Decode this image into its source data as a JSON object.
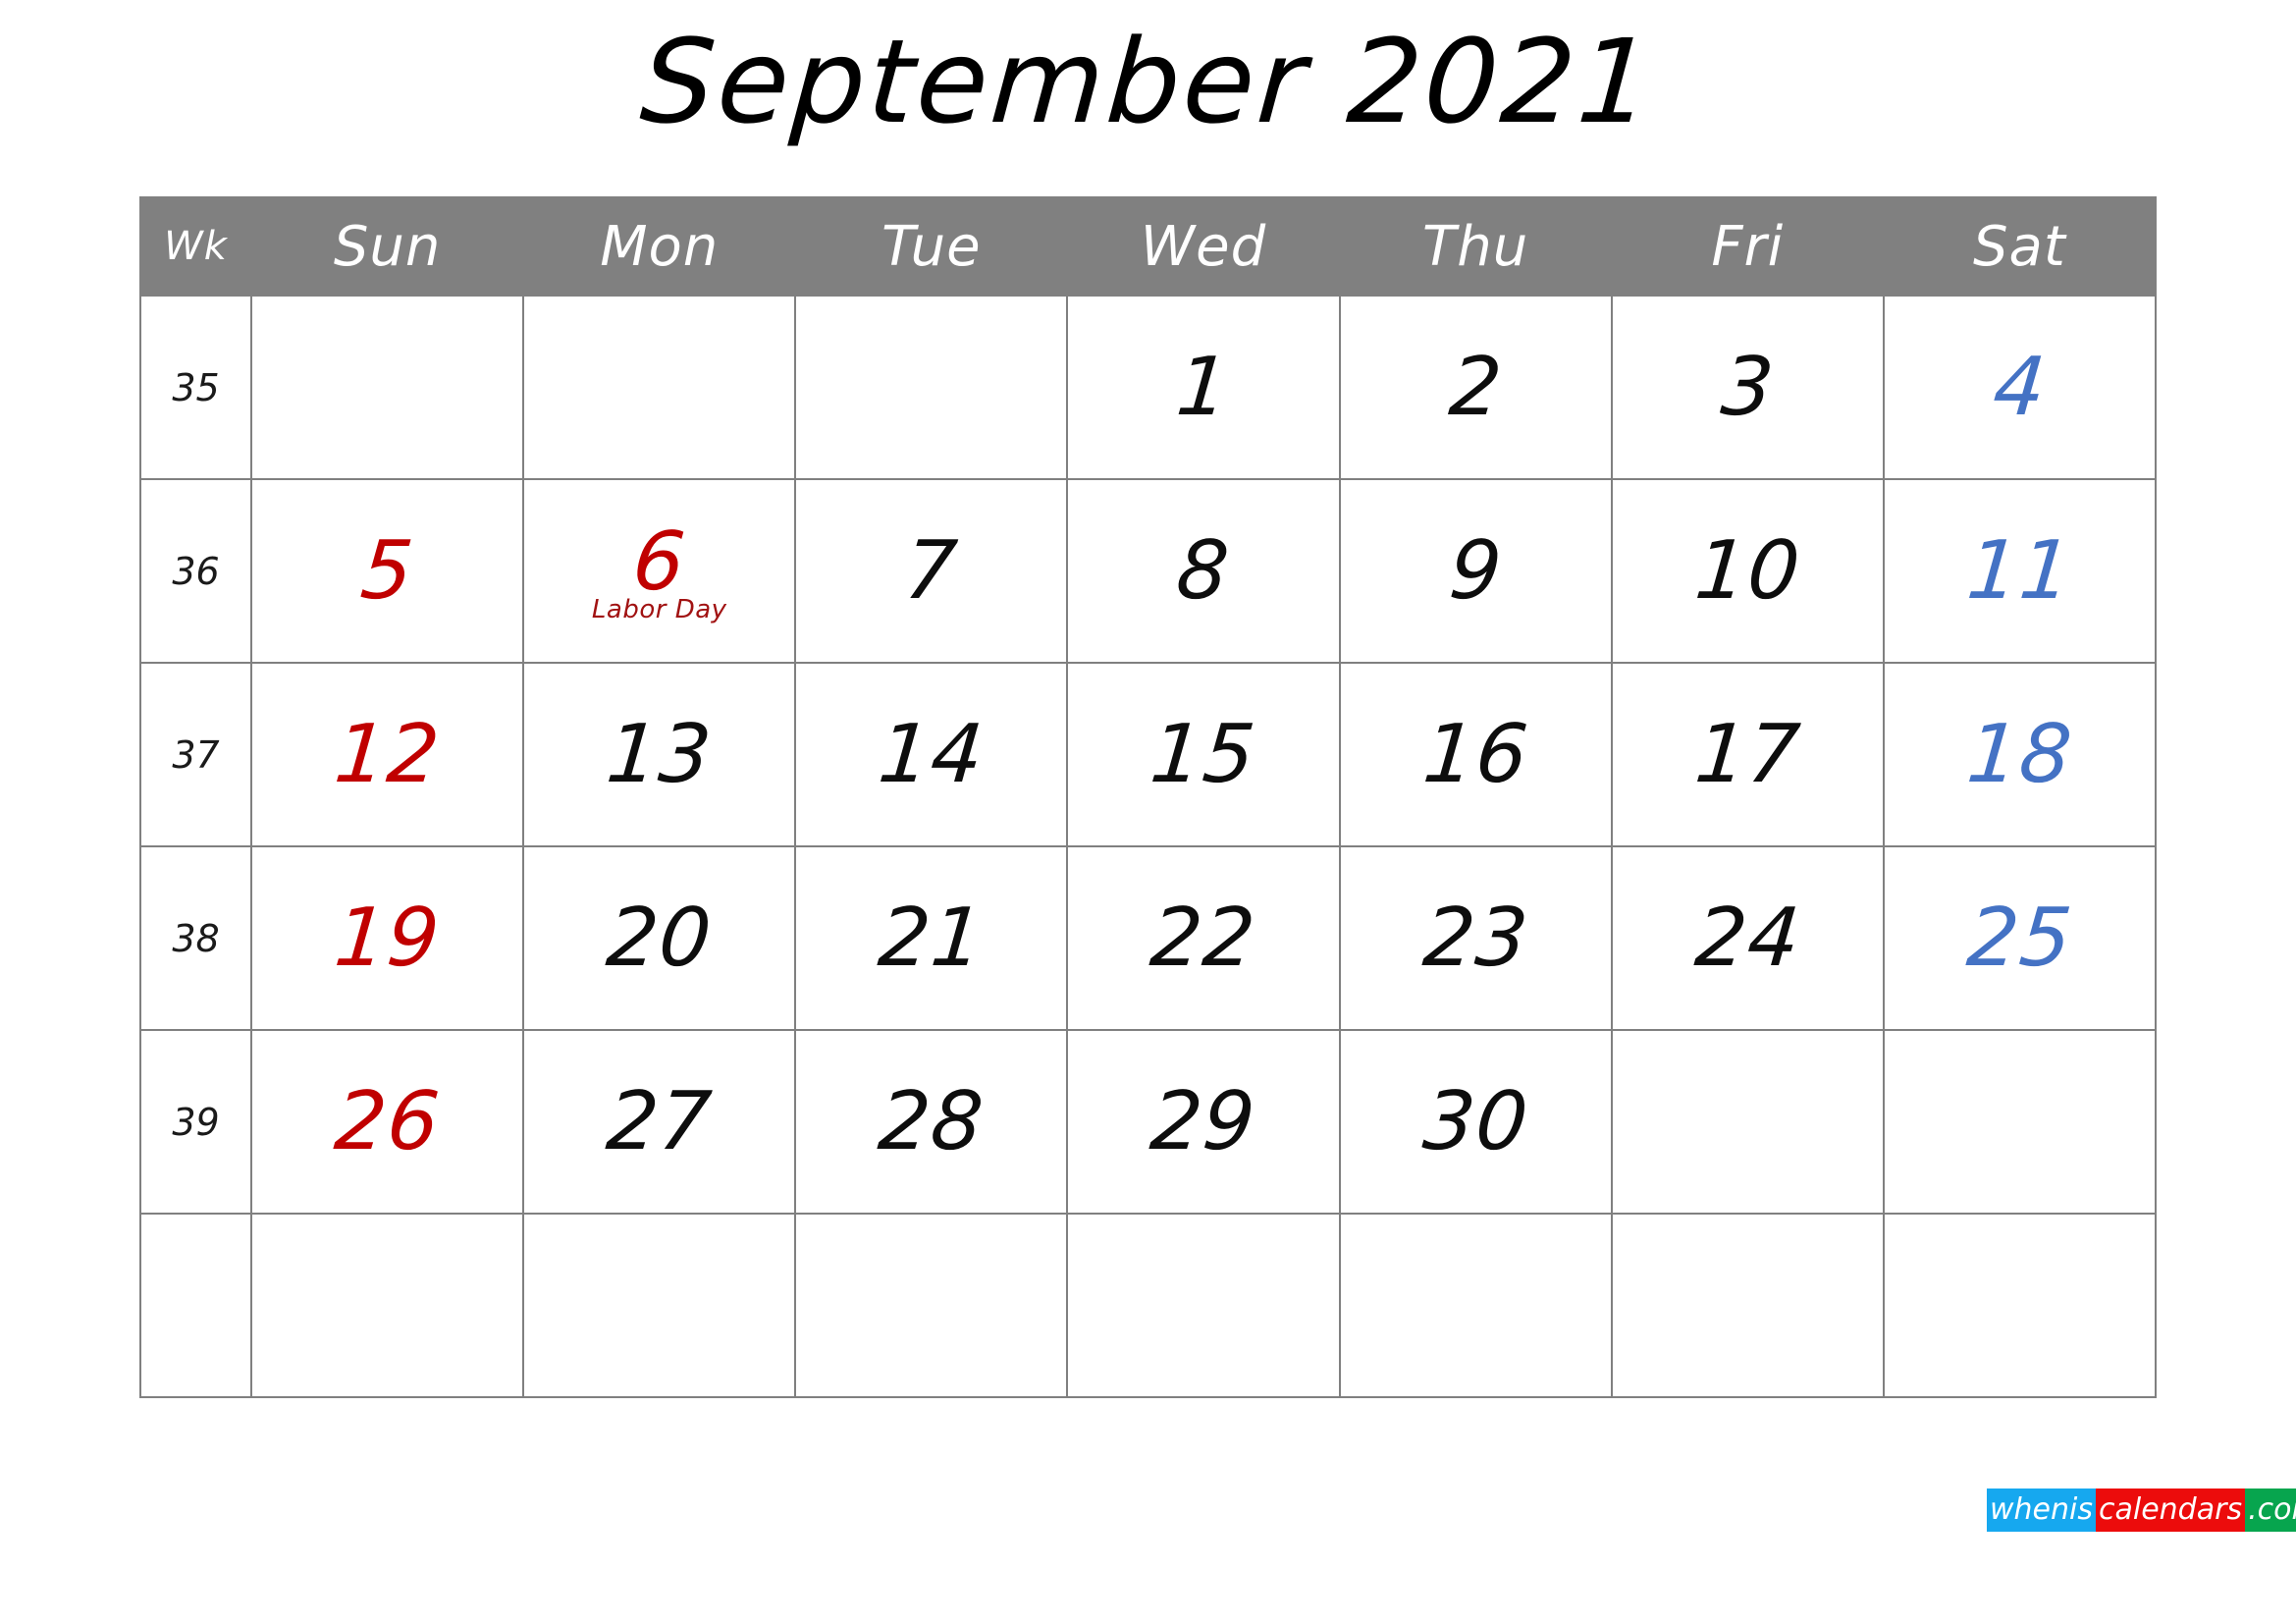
{
  "title": "September 2021",
  "header": {
    "wk_label": "Wk",
    "days": [
      "Sun",
      "Mon",
      "Tue",
      "Wed",
      "Thu",
      "Fri",
      "Sat"
    ]
  },
  "colors": {
    "header_background": "#808080",
    "header_text": "#ffffff",
    "grid_line": "#808080",
    "weekday": "#0d0d0d",
    "sunday": "#c00000",
    "saturday": "#4472c4",
    "event_text": "#a11212",
    "logo_blue": "#16a8ef",
    "logo_red": "#ec0c0c",
    "logo_green": "#07a54e"
  },
  "weeks": [
    {
      "wk": "35",
      "days": [
        {
          "num": "",
          "type": "sun"
        },
        {
          "num": "",
          "type": "wd"
        },
        {
          "num": "",
          "type": "wd"
        },
        {
          "num": "1",
          "type": "wd"
        },
        {
          "num": "2",
          "type": "wd"
        },
        {
          "num": "3",
          "type": "wd"
        },
        {
          "num": "4",
          "type": "sat"
        }
      ]
    },
    {
      "wk": "36",
      "days": [
        {
          "num": "5",
          "type": "sun"
        },
        {
          "num": "6",
          "type": "sun",
          "event": "Labor Day"
        },
        {
          "num": "7",
          "type": "wd"
        },
        {
          "num": "8",
          "type": "wd"
        },
        {
          "num": "9",
          "type": "wd"
        },
        {
          "num": "10",
          "type": "wd"
        },
        {
          "num": "11",
          "type": "sat"
        }
      ]
    },
    {
      "wk": "37",
      "days": [
        {
          "num": "12",
          "type": "sun"
        },
        {
          "num": "13",
          "type": "wd"
        },
        {
          "num": "14",
          "type": "wd"
        },
        {
          "num": "15",
          "type": "wd"
        },
        {
          "num": "16",
          "type": "wd"
        },
        {
          "num": "17",
          "type": "wd"
        },
        {
          "num": "18",
          "type": "sat"
        }
      ]
    },
    {
      "wk": "38",
      "days": [
        {
          "num": "19",
          "type": "sun"
        },
        {
          "num": "20",
          "type": "wd"
        },
        {
          "num": "21",
          "type": "wd"
        },
        {
          "num": "22",
          "type": "wd"
        },
        {
          "num": "23",
          "type": "wd"
        },
        {
          "num": "24",
          "type": "wd"
        },
        {
          "num": "25",
          "type": "sat"
        }
      ]
    },
    {
      "wk": "39",
      "days": [
        {
          "num": "26",
          "type": "sun"
        },
        {
          "num": "27",
          "type": "wd"
        },
        {
          "num": "28",
          "type": "wd"
        },
        {
          "num": "29",
          "type": "wd"
        },
        {
          "num": "30",
          "type": "wd"
        },
        {
          "num": "",
          "type": "wd"
        },
        {
          "num": "",
          "type": "sat"
        }
      ]
    },
    {
      "wk": "",
      "days": [
        {
          "num": "",
          "type": "sun"
        },
        {
          "num": "",
          "type": "wd"
        },
        {
          "num": "",
          "type": "wd"
        },
        {
          "num": "",
          "type": "wd"
        },
        {
          "num": "",
          "type": "wd"
        },
        {
          "num": "",
          "type": "wd"
        },
        {
          "num": "",
          "type": "sat"
        }
      ]
    }
  ],
  "logo": {
    "part1": "whenis",
    "part2": "calendars",
    "part3": ".com"
  }
}
